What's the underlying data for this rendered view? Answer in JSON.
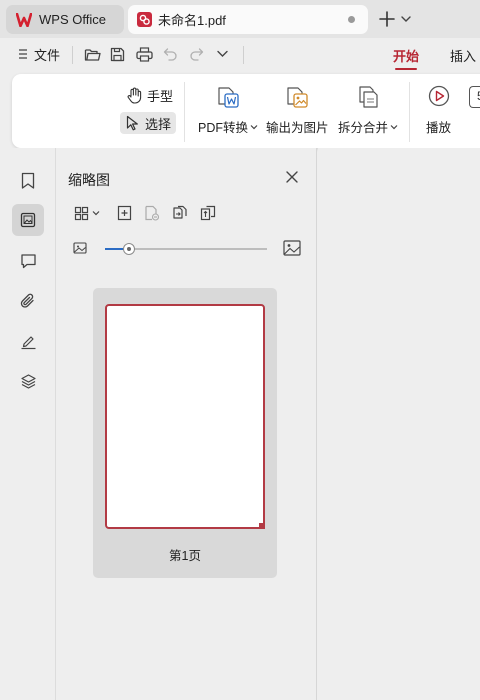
{
  "tabs": {
    "home_label": "WPS Office",
    "doc_label": "未命名1.pdf"
  },
  "quickbar": {
    "file_label": "文件"
  },
  "ribbon_tabs": [
    {
      "label": "开始",
      "active": true
    },
    {
      "label": "插入",
      "active": false
    }
  ],
  "ribbon": {
    "hand_label": "手型",
    "select_label": "选择",
    "pdf_convert_label": "PDF转换",
    "export_image_label": "输出为图片",
    "split_merge_label": "拆分合并",
    "play_label": "播放",
    "partial_tool_text": "5"
  },
  "thumbnail_panel": {
    "title": "缩略图",
    "zoom_level": 0.15,
    "pages": [
      {
        "label": "第1页",
        "selected": true
      }
    ]
  },
  "colors": {
    "accent": "#b72633",
    "thumb_border": "#b23a44",
    "slider": "#2b6cc4"
  }
}
